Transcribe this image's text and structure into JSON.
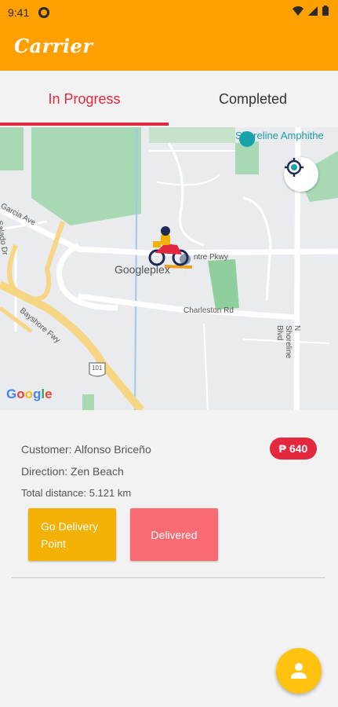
{
  "status_bar": {
    "time": "9:41",
    "notification_icon": "a-circle-icon",
    "icons": [
      "wifi-icon",
      "signal-icon",
      "battery-icon"
    ]
  },
  "app_bar": {
    "title": "Carrier",
    "color": "#FF9F00"
  },
  "tabs": [
    {
      "label": "In Progress",
      "selected": true
    },
    {
      "label": "Completed",
      "selected": false
    }
  ],
  "map": {
    "labels": {
      "poi_name": "Googleplex",
      "amphitheater": "Shoreline Amphithe",
      "garcia": "Garcia Ave",
      "salado": "Salado Dr",
      "charleston": "Charleston Rd",
      "bayshore": "Bayshore Fwy",
      "highway": "101",
      "centre_pkwy": "ntre Pkwy",
      "shoreline_blvd": "N Shoreline Blvd"
    },
    "attribution": "Google",
    "marker_icon": "motorcycle-rider-icon",
    "locate_icon": "gps-target-icon"
  },
  "order": {
    "customer": "Customer: Alfonso Briceño",
    "direction": "Direction: Zen Beach",
    "distance": "Total distance: 5.121 km",
    "price": "640",
    "currency_symbol": "₱"
  },
  "actions": {
    "go_label": "Go Delivery Point",
    "delivered_label": "Delivered"
  },
  "fab": {
    "icon": "person-icon"
  },
  "colors": {
    "accent": "#e4283f",
    "yellow_button": "#F3B106",
    "pink_button": "#F86B73",
    "fab": "#FFC20E"
  }
}
